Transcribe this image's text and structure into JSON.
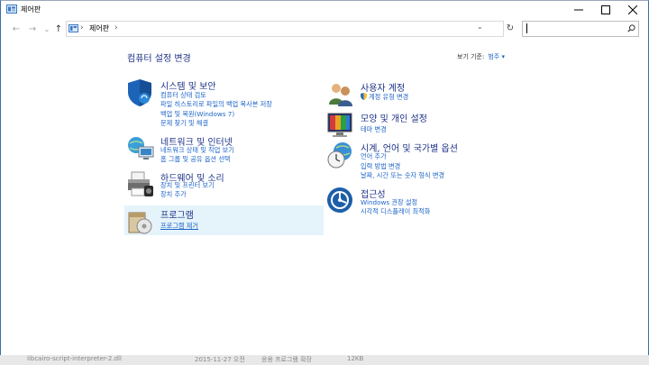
{
  "window": {
    "title": "제어판"
  },
  "address_bar": {
    "back": "←",
    "forward": "→",
    "recent": "⌄",
    "up": "↑",
    "separator1": "›",
    "crumb": "제어판",
    "separator2": "›",
    "dropdown": "⌄",
    "refresh": "↻",
    "search_placeholder": ""
  },
  "main": {
    "heading": "컴퓨터 설정 변경",
    "view_by_label": "보기 기준:",
    "view_by_value": "범주 ▾"
  },
  "left_categories": [
    {
      "title": "시스템 및 보안",
      "links": [
        "컴퓨터 상태 검토",
        "파일 히스토리로 파일의 백업 복사본 저장",
        "백업 및 복원(Windows 7)",
        "문제 찾기 및 해결"
      ],
      "icon": "shield-icon"
    },
    {
      "title": "네트워크 및 인터넷",
      "links": [
        "네트워크 상태 및 작업 보기",
        "홈 그룹 및 공유 옵션 선택"
      ],
      "icon": "network-icon"
    },
    {
      "title": "하드웨어 및 소리",
      "links": [
        "장치 및 프린터 보기",
        "장치 추가"
      ],
      "icon": "printer-icon"
    },
    {
      "title": "프로그램",
      "links": [
        "프로그램 제거"
      ],
      "icon": "programs-icon"
    }
  ],
  "right_categories": [
    {
      "title": "사용자 계정",
      "links": [
        "계정 유형 변경"
      ],
      "icon": "users-icon"
    },
    {
      "title": "모양 및 개인 설정",
      "links": [
        "테마 변경"
      ],
      "icon": "appearance-icon"
    },
    {
      "title": "시계, 언어 및 국가별 옵션",
      "links": [
        "언어 추가",
        "입력 방법 변경",
        "날짜, 시간 또는 숫자 형식 변경"
      ],
      "icon": "clock-globe-icon"
    },
    {
      "title": "접근성",
      "links": [
        "Windows 권장 설정",
        "시각적 디스플레이 최적화"
      ],
      "icon": "ease-of-access-icon"
    }
  ],
  "background_window": {
    "file_name": "libcairo-script-interpreter-2.dll",
    "date": "2015-11-27 오전",
    "type": "응용 프로그램 확장",
    "size": "12KB"
  },
  "colors": {
    "heading": "#1e3287",
    "link": "#1e64c8",
    "highlight": "#e5f3fb"
  }
}
